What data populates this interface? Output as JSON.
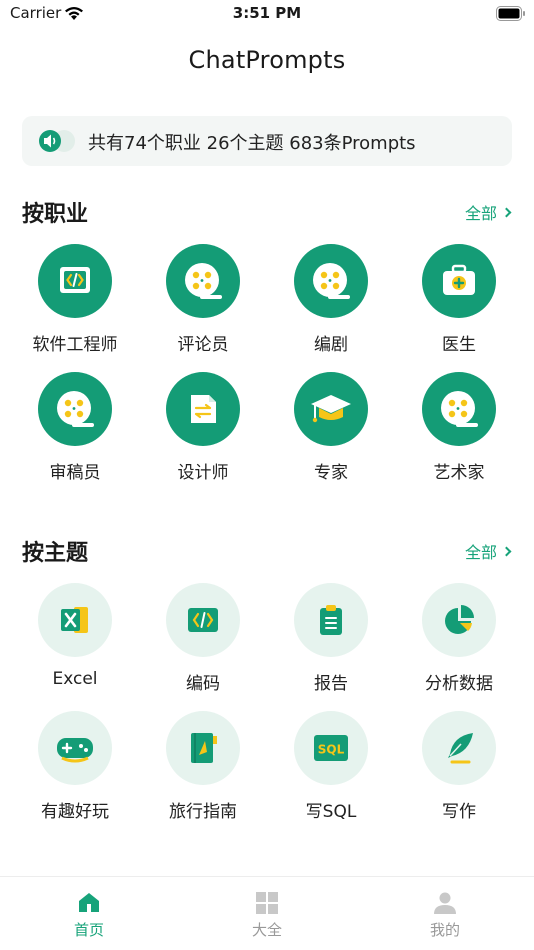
{
  "status_bar": {
    "carrier": "Carrier",
    "time": "3:51 PM"
  },
  "header": {
    "title": "ChatPrompts"
  },
  "banner": {
    "text": "共有74个职业 26个主题 683条Prompts",
    "icon": "speaker-icon"
  },
  "occupations": {
    "title": "按职业",
    "see_all": "全部",
    "items": [
      {
        "label": "软件工程师",
        "icon": "code-icon"
      },
      {
        "label": "评论员",
        "icon": "film-reel-icon"
      },
      {
        "label": "编剧",
        "icon": "film-reel-icon"
      },
      {
        "label": "医生",
        "icon": "medical-kit-icon"
      },
      {
        "label": "审稿员",
        "icon": "film-reel-icon"
      },
      {
        "label": "设计师",
        "icon": "file-swap-icon"
      },
      {
        "label": "专家",
        "icon": "graduation-cap-icon"
      },
      {
        "label": "艺术家",
        "icon": "film-reel-icon"
      }
    ]
  },
  "topics": {
    "title": "按主题",
    "see_all": "全部",
    "items": [
      {
        "label": "Excel",
        "icon": "excel-icon"
      },
      {
        "label": "编码",
        "icon": "code-icon"
      },
      {
        "label": "报告",
        "icon": "clipboard-icon"
      },
      {
        "label": "分析数据",
        "icon": "pie-chart-icon"
      },
      {
        "label": "有趣好玩",
        "icon": "gamepad-icon"
      },
      {
        "label": "旅行指南",
        "icon": "guide-book-icon"
      },
      {
        "label": "写SQL",
        "icon": "sql-icon",
        "badge": "SQL"
      },
      {
        "label": "写作",
        "icon": "feather-icon"
      }
    ]
  },
  "tabs": [
    {
      "label": "首页",
      "icon": "home-icon",
      "active": true
    },
    {
      "label": "大全",
      "icon": "grid-icon",
      "active": false
    },
    {
      "label": "我的",
      "icon": "user-icon",
      "active": false
    }
  ],
  "colors": {
    "primary": "#149c76",
    "accent": "#f5c518",
    "light_bg": "#e6f3ee"
  }
}
